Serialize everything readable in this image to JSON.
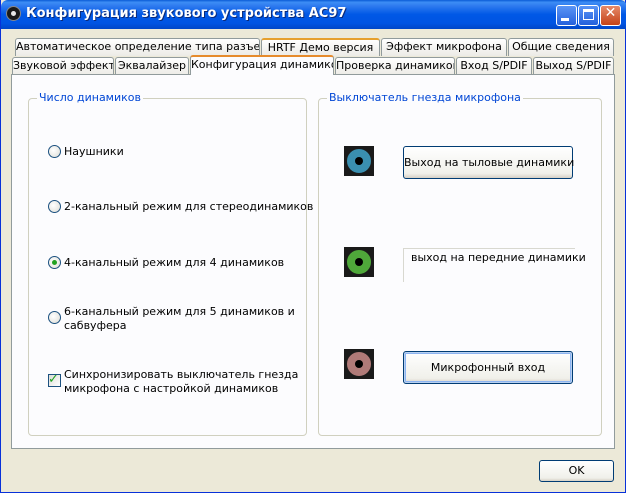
{
  "window": {
    "title": "Конфигурация звукового устройства AC97",
    "close_glyph": "✕"
  },
  "tabs": {
    "row_back": [
      {
        "label": "Автоматическое определение типа разъема"
      },
      {
        "label": "HRTF Демо версия"
      },
      {
        "label": "Эффект микрофона"
      },
      {
        "label": "Общие сведения"
      }
    ],
    "row_front": [
      {
        "label": "Звуковой эффект"
      },
      {
        "label": "Эквалайзер"
      },
      {
        "label": "Конфигурация динамиков",
        "selected": true
      },
      {
        "label": "Проверка динамиков"
      },
      {
        "label": "Вход S/PDIF"
      },
      {
        "label": "Выход S/PDIF"
      }
    ]
  },
  "speakers": {
    "group_label": "Число динамиков",
    "options": [
      {
        "line1": "Наушники",
        "selected": false
      },
      {
        "line1": "2-канальный режим для стереодинамиков",
        "selected": false
      },
      {
        "line1": "4-канальный режим для 4 динамиков",
        "selected": true
      },
      {
        "line1": "6-канальный режим для 5 динамиков и",
        "line2": "сабвуфера",
        "selected": false
      }
    ],
    "sync_checkbox": {
      "line1": "Синхронизировать выключатель гнезда",
      "line2": "микрофона с настройкой динамиков",
      "checked": true
    }
  },
  "mic_switch": {
    "group_label": "Выключатель гнезда микрофона",
    "jacks": [
      {
        "icon": "blue-audio-jack-icon",
        "color": "#3a8fb0",
        "label": "Выход на тыловые динамики",
        "kind": "button"
      },
      {
        "icon": "green-audio-jack-icon",
        "color": "#4fa83a",
        "label": "выход на передние динамики",
        "kind": "static"
      },
      {
        "icon": "pink-audio-jack-icon",
        "color": "#b07a78",
        "label": "Микрофонный вход",
        "kind": "button"
      }
    ]
  },
  "footer": {
    "ok_label": "OK"
  },
  "colors": {
    "titlebar": "#0054e3",
    "group_label": "#0046d5",
    "tab_highlight": "#e68b2c",
    "window_bg": "#ece9d8"
  }
}
